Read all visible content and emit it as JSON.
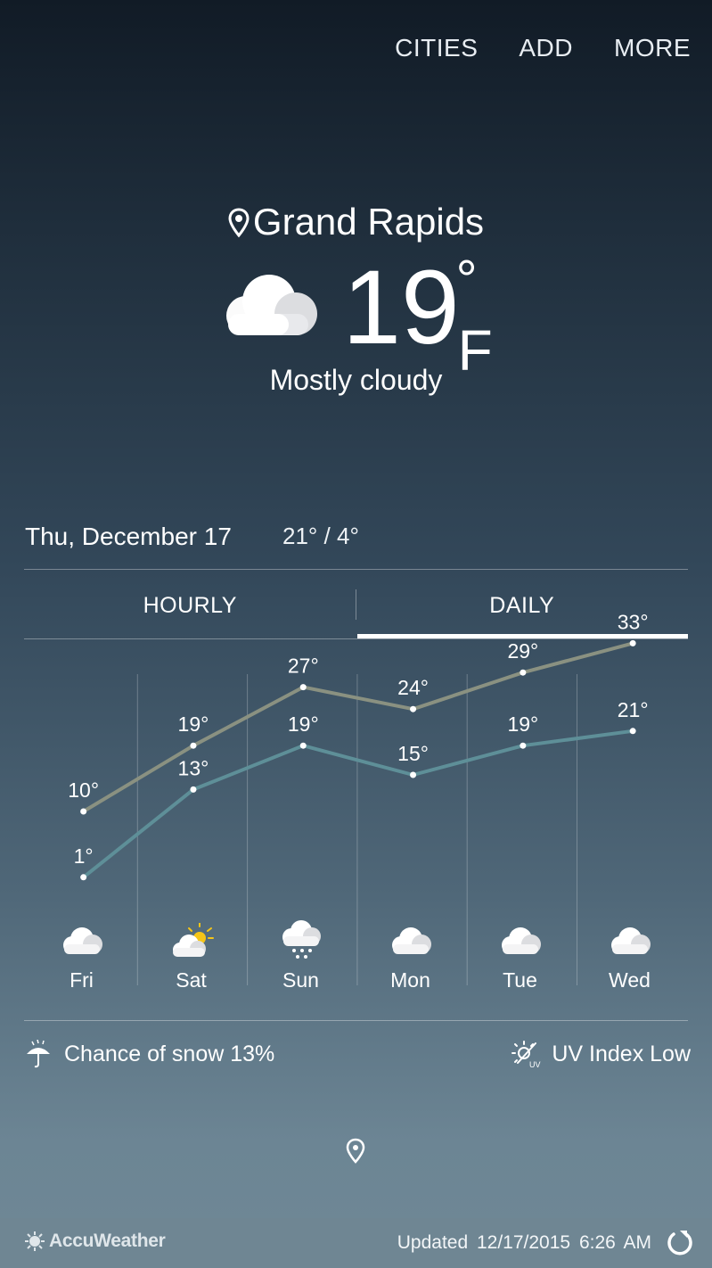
{
  "topbar": {
    "cities": "CITIES",
    "add": "ADD",
    "more": "MORE"
  },
  "location": {
    "city": "Grand Rapids"
  },
  "current": {
    "temp": "19",
    "deg": "°",
    "unit": "F",
    "condition": "Mostly cloudy",
    "icon": "cloud-icon"
  },
  "today": {
    "date": "Thu, December 17",
    "hilo": "21° / 4°"
  },
  "tabs": {
    "hourly": "HOURLY",
    "daily": "DAILY",
    "active": "DAILY"
  },
  "daily": [
    {
      "day": "Fri",
      "high": "10°",
      "low": "1°",
      "icon": "cloud-icon"
    },
    {
      "day": "Sat",
      "high": "19°",
      "low": "13°",
      "icon": "partly-sunny-icon"
    },
    {
      "day": "Sun",
      "high": "27°",
      "low": "19°",
      "icon": "snow-icon"
    },
    {
      "day": "Mon",
      "high": "24°",
      "low": "15°",
      "icon": "cloud-icon"
    },
    {
      "day": "Tue",
      "high": "29°",
      "low": "19°",
      "icon": "cloud-icon"
    },
    {
      "day": "Wed",
      "high": "33°",
      "low": "21°",
      "icon": "cloud-icon"
    }
  ],
  "chart_data": {
    "type": "line",
    "categories": [
      "Fri",
      "Sat",
      "Sun",
      "Mon",
      "Tue",
      "Wed"
    ],
    "series": [
      {
        "values": [
          10,
          19,
          27,
          24,
          29,
          33
        ],
        "color": "#8a9181"
      },
      {
        "values": [
          1,
          13,
          19,
          15,
          19,
          21
        ],
        "color": "#5e8f98"
      }
    ]
  },
  "info": {
    "snow": "Chance of snow 13%",
    "uv": "UV Index Low"
  },
  "footer": {
    "brand": "AccuWeather",
    "updated_label": "Updated",
    "updated_date": "12/17/2015",
    "updated_time": "6:26 AM"
  }
}
